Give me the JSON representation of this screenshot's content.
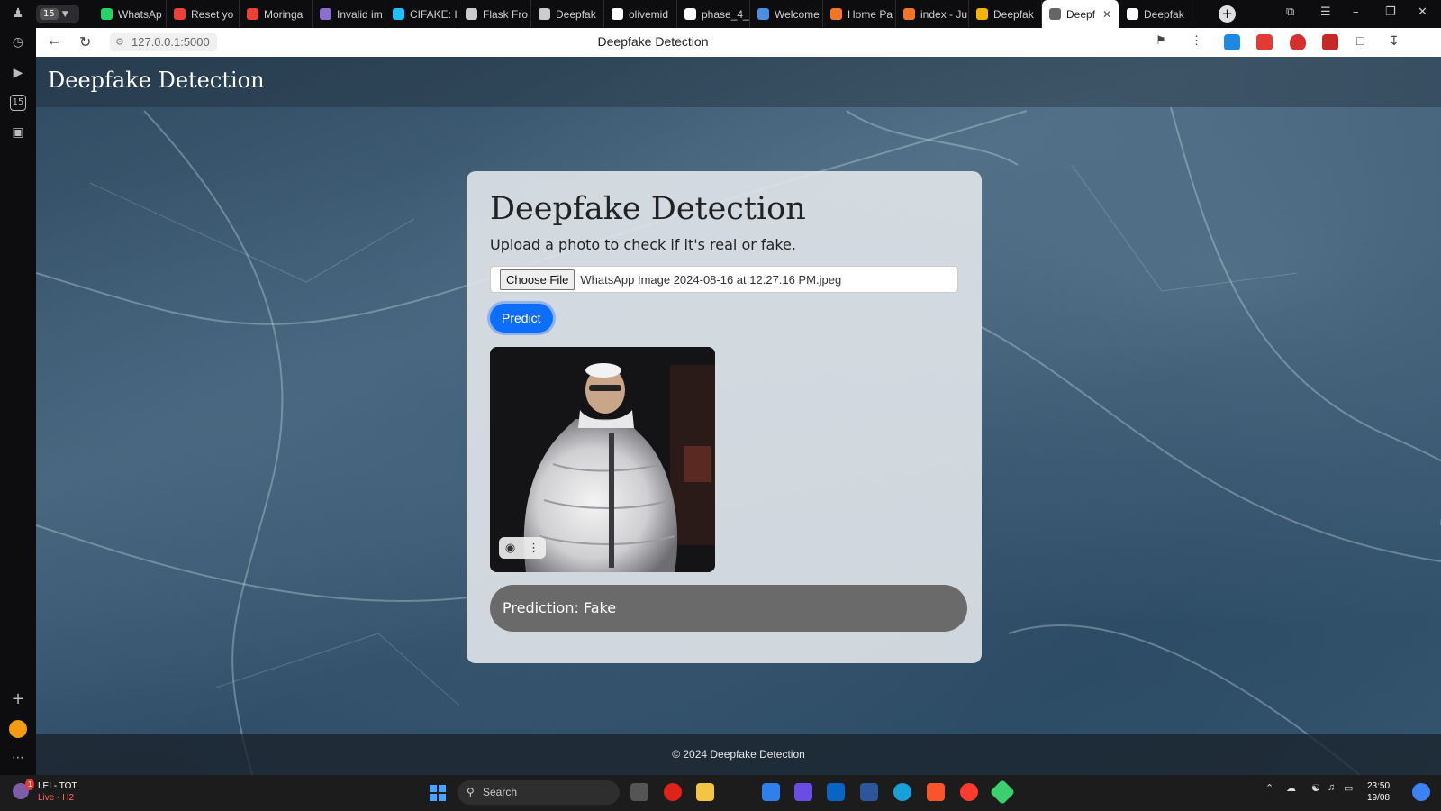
{
  "browser": {
    "tab_count": "15",
    "tabs": [
      {
        "label": "WhatsAp",
        "color": "#25d366"
      },
      {
        "label": "Reset yo",
        "color": "#ea4335"
      },
      {
        "label": "Moringa",
        "color": "#ea4335"
      },
      {
        "label": "Invalid im",
        "color": "#8a6fd1"
      },
      {
        "label": "CIFAKE: I",
        "color": "#20beff"
      },
      {
        "label": "Flask Fro",
        "color": "#cccccc"
      },
      {
        "label": "Deepfak",
        "color": "#cccccc"
      },
      {
        "label": "olivemid",
        "color": "#ffffff"
      },
      {
        "label": "phase_4_",
        "color": "#ffffff"
      },
      {
        "label": "Welcome",
        "color": "#4a90e2"
      },
      {
        "label": "Home Pa",
        "color": "#f37626"
      },
      {
        "label": "index - Ju",
        "color": "#f37626"
      },
      {
        "label": "Deepfak",
        "color": "#f4b400"
      }
    ],
    "active_tab": {
      "label": "Deepf",
      "close": "✕"
    },
    "last_tab": {
      "label": "Deepfak"
    },
    "url": "127.0.0.1:5000",
    "page_title": "Deepfake Detection",
    "sidebar_badge": "15"
  },
  "site": {
    "brand": "Deepfake Detection",
    "heading": "Deepfake Detection",
    "subtitle": "Upload a photo to check if it's real or fake.",
    "choose_file_label": "Choose File",
    "file_name": "WhatsApp Image 2024-08-16 at 12.27.16 PM.jpeg",
    "predict_label": "Predict",
    "prediction_text": "Prediction: Fake",
    "footer": "© 2024 Deepfake Detection"
  },
  "taskbar": {
    "weather_title": "LEI - TOT",
    "weather_sub": "Live - H2",
    "weather_badge": "1",
    "search_placeholder": "Search",
    "time": "23:50",
    "date": "19/08"
  },
  "colors": {
    "primary_button": "#0d6efd",
    "prediction_bg": "#6a6a6a"
  }
}
